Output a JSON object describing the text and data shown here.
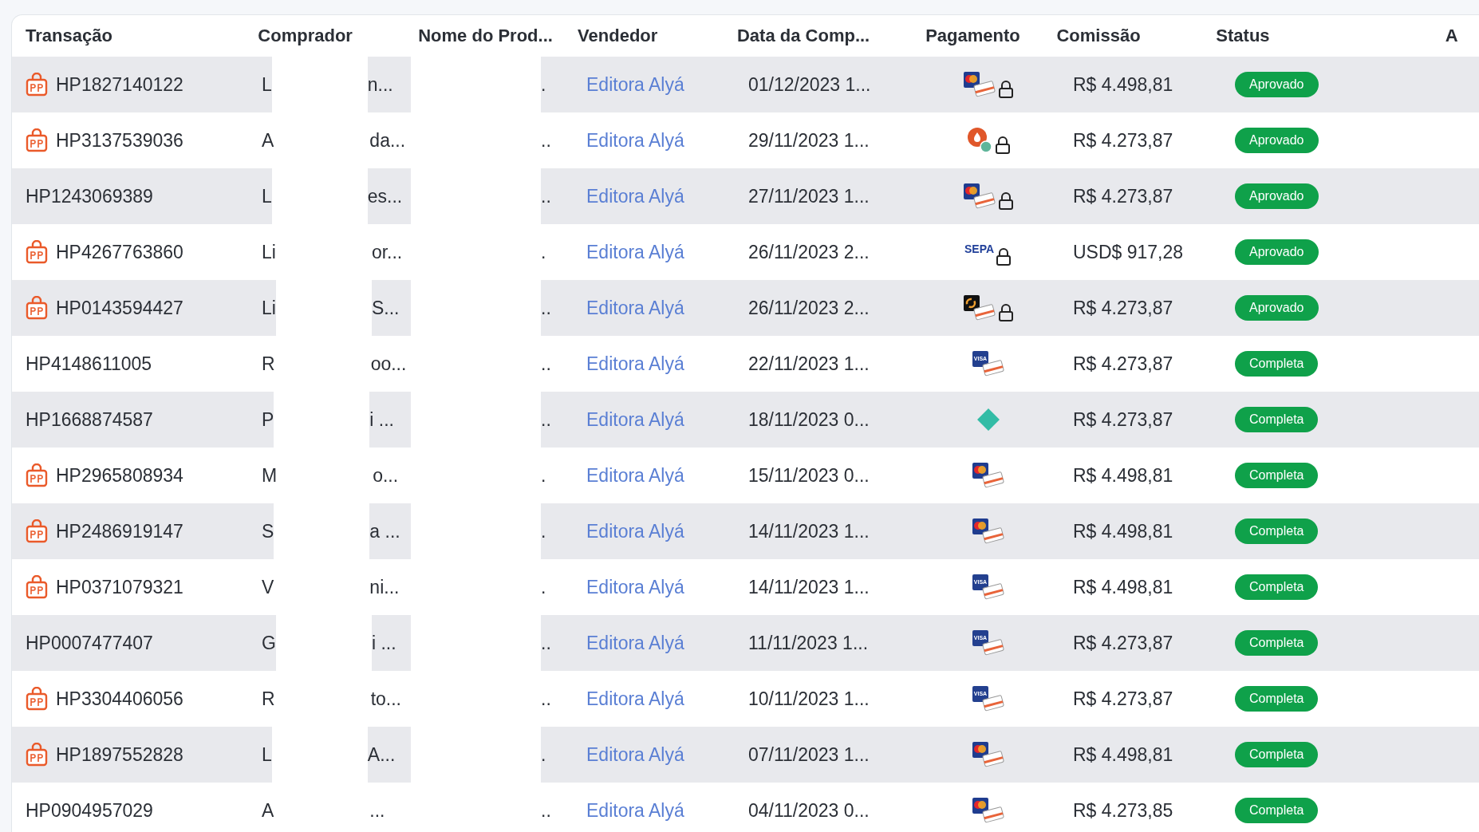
{
  "table": {
    "columns": [
      "Transação",
      "Comprador",
      "Nome do Prod...",
      "Vendedor",
      "Data da Comp...",
      "Pagamento",
      "Comissão",
      "Status",
      "A"
    ],
    "rows": [
      {
        "bag_icon": true,
        "id": "HP1827140122",
        "buyer_start": "L",
        "buyer_end": "n...",
        "product_end": ".",
        "seller": "Editora Alyá",
        "date": "01/12/2023 1...",
        "payment": {
          "kind": "mastercard",
          "locked": true
        },
        "commission": "R$ 4.498,81",
        "status": {
          "label": "Aprovado",
          "color": "#0fa14a"
        }
      },
      {
        "bag_icon": true,
        "id": "HP3137539036",
        "buyer_start": "A",
        "buyer_end": "da...",
        "product_end": "..",
        "seller": "Editora Alyá",
        "date": "29/11/2023 1...",
        "payment": {
          "kind": "coin",
          "locked": true
        },
        "commission": "R$ 4.273,87",
        "status": {
          "label": "Aprovado",
          "color": "#0fa14a"
        }
      },
      {
        "bag_icon": false,
        "id": "HP1243069389",
        "buyer_start": "L",
        "buyer_end": "es...",
        "product_end": "..",
        "seller": "Editora Alyá",
        "date": "27/11/2023 1...",
        "payment": {
          "kind": "mastercard",
          "locked": true
        },
        "commission": "R$ 4.273,87",
        "status": {
          "label": "Aprovado",
          "color": "#0fa14a"
        }
      },
      {
        "bag_icon": true,
        "id": "HP4267763860",
        "buyer_start": "Li",
        "buyer_end": "or...",
        "product_end": ".",
        "seller": "Editora Alyá",
        "date": "26/11/2023 2...",
        "payment": {
          "kind": "sepa",
          "logo_text": "SEPA",
          "locked": true
        },
        "commission": "USD$ 917,28",
        "status": {
          "label": "Aprovado",
          "color": "#0fa14a"
        }
      },
      {
        "bag_icon": true,
        "id": "HP0143594427",
        "buyer_start": "Li",
        "buyer_end": "S...",
        "product_end": "..",
        "seller": "Editora Alyá",
        "date": "26/11/2023 2...",
        "payment": {
          "kind": "dark-card",
          "locked": true
        },
        "commission": "R$ 4.273,87",
        "status": {
          "label": "Aprovado",
          "color": "#0fa14a"
        }
      },
      {
        "bag_icon": false,
        "id": "HP4148611005",
        "buyer_start": "R",
        "buyer_end": "oo...",
        "product_end": "..",
        "seller": "Editora Alyá",
        "date": "22/11/2023 1...",
        "payment": {
          "kind": "visa",
          "logo_text": "VISA",
          "locked": false
        },
        "commission": "R$ 4.273,87",
        "status": {
          "label": "Completa",
          "color": "#0fa14a"
        }
      },
      {
        "bag_icon": false,
        "id": "HP1668874587",
        "buyer_start": "P",
        "buyer_end": "i ...",
        "product_end": "..",
        "seller": "Editora Alyá",
        "date": "18/11/2023 0...",
        "payment": {
          "kind": "pix",
          "locked": false
        },
        "commission": "R$ 4.273,87",
        "status": {
          "label": "Completa",
          "color": "#0fa14a"
        }
      },
      {
        "bag_icon": true,
        "id": "HP2965808934",
        "buyer_start": "M",
        "buyer_end": "o...",
        "product_end": ".",
        "seller": "Editora Alyá",
        "date": "15/11/2023 0...",
        "payment": {
          "kind": "mastercard",
          "locked": false
        },
        "commission": "R$ 4.498,81",
        "status": {
          "label": "Completa",
          "color": "#0fa14a"
        }
      },
      {
        "bag_icon": true,
        "id": "HP2486919147",
        "buyer_start": "S",
        "buyer_end": "a ...",
        "product_end": ".",
        "seller": "Editora Alyá",
        "date": "14/11/2023 1...",
        "payment": {
          "kind": "mastercard",
          "locked": false
        },
        "commission": "R$ 4.498,81",
        "status": {
          "label": "Completa",
          "color": "#0fa14a"
        }
      },
      {
        "bag_icon": true,
        "id": "HP0371079321",
        "buyer_start": "V",
        "buyer_end": "ni...",
        "product_end": ".",
        "seller": "Editora Alyá",
        "date": "14/11/2023 1...",
        "payment": {
          "kind": "visa",
          "logo_text": "VISA",
          "locked": false
        },
        "commission": "R$ 4.498,81",
        "status": {
          "label": "Completa",
          "color": "#0fa14a"
        }
      },
      {
        "bag_icon": false,
        "id": "HP0007477407",
        "buyer_start": "G",
        "buyer_end": "i ...",
        "product_end": "..",
        "seller": "Editora Alyá",
        "date": "11/11/2023 1...",
        "payment": {
          "kind": "visa",
          "logo_text": "VISA",
          "locked": false
        },
        "commission": "R$ 4.273,87",
        "status": {
          "label": "Completa",
          "color": "#0fa14a"
        }
      },
      {
        "bag_icon": true,
        "id": "HP3304406056",
        "buyer_start": "R",
        "buyer_end": "to...",
        "product_end": "..",
        "seller": "Editora Alyá",
        "date": "10/11/2023 1...",
        "payment": {
          "kind": "visa",
          "logo_text": "VISA",
          "locked": false
        },
        "commission": "R$ 4.273,87",
        "status": {
          "label": "Completa",
          "color": "#0fa14a"
        }
      },
      {
        "bag_icon": true,
        "id": "HP1897552828",
        "buyer_start": "L",
        "buyer_end": "A...",
        "product_end": ".",
        "seller": "Editora Alyá",
        "date": "07/11/2023 1...",
        "payment": {
          "kind": "mastercard",
          "locked": false
        },
        "commission": "R$ 4.498,81",
        "status": {
          "label": "Completa",
          "color": "#0fa14a"
        }
      },
      {
        "bag_icon": false,
        "id": "HP0904957029",
        "buyer_start": "A",
        "buyer_end": "...",
        "product_end": "..",
        "seller": "Editora Alyá",
        "date": "04/11/2023 0...",
        "payment": {
          "kind": "mastercard",
          "locked": false
        },
        "commission": "R$ 4.273,85",
        "status": {
          "label": "Completa",
          "color": "#0fa14a"
        }
      }
    ]
  }
}
